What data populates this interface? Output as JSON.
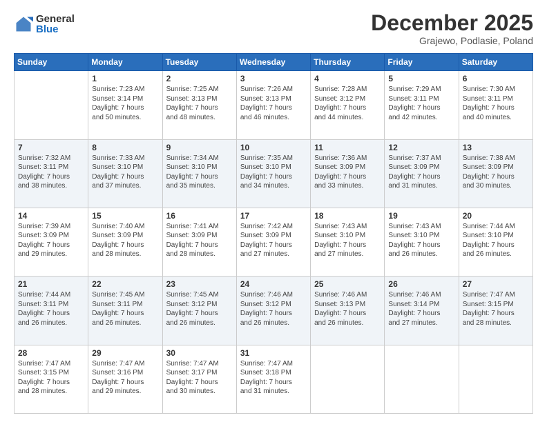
{
  "logo": {
    "general": "General",
    "blue": "Blue"
  },
  "header": {
    "month": "December 2025",
    "location": "Grajewo, Podlasie, Poland"
  },
  "days": [
    "Sunday",
    "Monday",
    "Tuesday",
    "Wednesday",
    "Thursday",
    "Friday",
    "Saturday"
  ],
  "weeks": [
    [
      {
        "day": "",
        "info": ""
      },
      {
        "day": "1",
        "info": "Sunrise: 7:23 AM\nSunset: 3:14 PM\nDaylight: 7 hours\nand 50 minutes."
      },
      {
        "day": "2",
        "info": "Sunrise: 7:25 AM\nSunset: 3:13 PM\nDaylight: 7 hours\nand 48 minutes."
      },
      {
        "day": "3",
        "info": "Sunrise: 7:26 AM\nSunset: 3:13 PM\nDaylight: 7 hours\nand 46 minutes."
      },
      {
        "day": "4",
        "info": "Sunrise: 7:28 AM\nSunset: 3:12 PM\nDaylight: 7 hours\nand 44 minutes."
      },
      {
        "day": "5",
        "info": "Sunrise: 7:29 AM\nSunset: 3:11 PM\nDaylight: 7 hours\nand 42 minutes."
      },
      {
        "day": "6",
        "info": "Sunrise: 7:30 AM\nSunset: 3:11 PM\nDaylight: 7 hours\nand 40 minutes."
      }
    ],
    [
      {
        "day": "7",
        "info": "Sunrise: 7:32 AM\nSunset: 3:11 PM\nDaylight: 7 hours\nand 38 minutes."
      },
      {
        "day": "8",
        "info": "Sunrise: 7:33 AM\nSunset: 3:10 PM\nDaylight: 7 hours\nand 37 minutes."
      },
      {
        "day": "9",
        "info": "Sunrise: 7:34 AM\nSunset: 3:10 PM\nDaylight: 7 hours\nand 35 minutes."
      },
      {
        "day": "10",
        "info": "Sunrise: 7:35 AM\nSunset: 3:10 PM\nDaylight: 7 hours\nand 34 minutes."
      },
      {
        "day": "11",
        "info": "Sunrise: 7:36 AM\nSunset: 3:09 PM\nDaylight: 7 hours\nand 33 minutes."
      },
      {
        "day": "12",
        "info": "Sunrise: 7:37 AM\nSunset: 3:09 PM\nDaylight: 7 hours\nand 31 minutes."
      },
      {
        "day": "13",
        "info": "Sunrise: 7:38 AM\nSunset: 3:09 PM\nDaylight: 7 hours\nand 30 minutes."
      }
    ],
    [
      {
        "day": "14",
        "info": "Sunrise: 7:39 AM\nSunset: 3:09 PM\nDaylight: 7 hours\nand 29 minutes."
      },
      {
        "day": "15",
        "info": "Sunrise: 7:40 AM\nSunset: 3:09 PM\nDaylight: 7 hours\nand 28 minutes."
      },
      {
        "day": "16",
        "info": "Sunrise: 7:41 AM\nSunset: 3:09 PM\nDaylight: 7 hours\nand 28 minutes."
      },
      {
        "day": "17",
        "info": "Sunrise: 7:42 AM\nSunset: 3:09 PM\nDaylight: 7 hours\nand 27 minutes."
      },
      {
        "day": "18",
        "info": "Sunrise: 7:43 AM\nSunset: 3:10 PM\nDaylight: 7 hours\nand 27 minutes."
      },
      {
        "day": "19",
        "info": "Sunrise: 7:43 AM\nSunset: 3:10 PM\nDaylight: 7 hours\nand 26 minutes."
      },
      {
        "day": "20",
        "info": "Sunrise: 7:44 AM\nSunset: 3:10 PM\nDaylight: 7 hours\nand 26 minutes."
      }
    ],
    [
      {
        "day": "21",
        "info": "Sunrise: 7:44 AM\nSunset: 3:11 PM\nDaylight: 7 hours\nand 26 minutes."
      },
      {
        "day": "22",
        "info": "Sunrise: 7:45 AM\nSunset: 3:11 PM\nDaylight: 7 hours\nand 26 minutes."
      },
      {
        "day": "23",
        "info": "Sunrise: 7:45 AM\nSunset: 3:12 PM\nDaylight: 7 hours\nand 26 minutes."
      },
      {
        "day": "24",
        "info": "Sunrise: 7:46 AM\nSunset: 3:12 PM\nDaylight: 7 hours\nand 26 minutes."
      },
      {
        "day": "25",
        "info": "Sunrise: 7:46 AM\nSunset: 3:13 PM\nDaylight: 7 hours\nand 26 minutes."
      },
      {
        "day": "26",
        "info": "Sunrise: 7:46 AM\nSunset: 3:14 PM\nDaylight: 7 hours\nand 27 minutes."
      },
      {
        "day": "27",
        "info": "Sunrise: 7:47 AM\nSunset: 3:15 PM\nDaylight: 7 hours\nand 28 minutes."
      }
    ],
    [
      {
        "day": "28",
        "info": "Sunrise: 7:47 AM\nSunset: 3:15 PM\nDaylight: 7 hours\nand 28 minutes."
      },
      {
        "day": "29",
        "info": "Sunrise: 7:47 AM\nSunset: 3:16 PM\nDaylight: 7 hours\nand 29 minutes."
      },
      {
        "day": "30",
        "info": "Sunrise: 7:47 AM\nSunset: 3:17 PM\nDaylight: 7 hours\nand 30 minutes."
      },
      {
        "day": "31",
        "info": "Sunrise: 7:47 AM\nSunset: 3:18 PM\nDaylight: 7 hours\nand 31 minutes."
      },
      {
        "day": "",
        "info": ""
      },
      {
        "day": "",
        "info": ""
      },
      {
        "day": "",
        "info": ""
      }
    ]
  ]
}
